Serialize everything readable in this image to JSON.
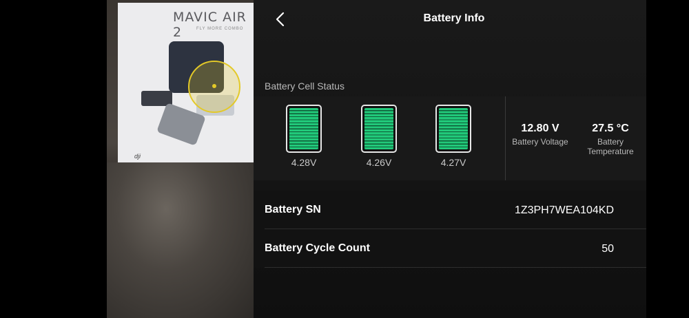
{
  "header": {
    "title": "Battery Info",
    "back_icon": "chevron-left-icon"
  },
  "camera_feed": {
    "box_title": "MAVIC AIR 2",
    "box_subtitle": "FLY MORE COMBO",
    "brand": "dji"
  },
  "cell_status": {
    "label": "Battery Cell Status",
    "cells": [
      {
        "voltage": "4.28V",
        "level": 1.0
      },
      {
        "voltage": "4.26V",
        "level": 1.0
      },
      {
        "voltage": "4.27V",
        "level": 1.0
      }
    ],
    "fill_color": "#21c97a"
  },
  "stats": {
    "voltage_value": "12.80 V",
    "voltage_label": "Battery Voltage",
    "temperature_value": "27.5 °C",
    "temperature_label_line1": "Battery",
    "temperature_label_line2": "Temperature"
  },
  "details": {
    "sn_label": "Battery SN",
    "sn_value": "1Z3PH7WEA104KD",
    "cycle_label": "Battery Cycle Count",
    "cycle_value": "50"
  }
}
